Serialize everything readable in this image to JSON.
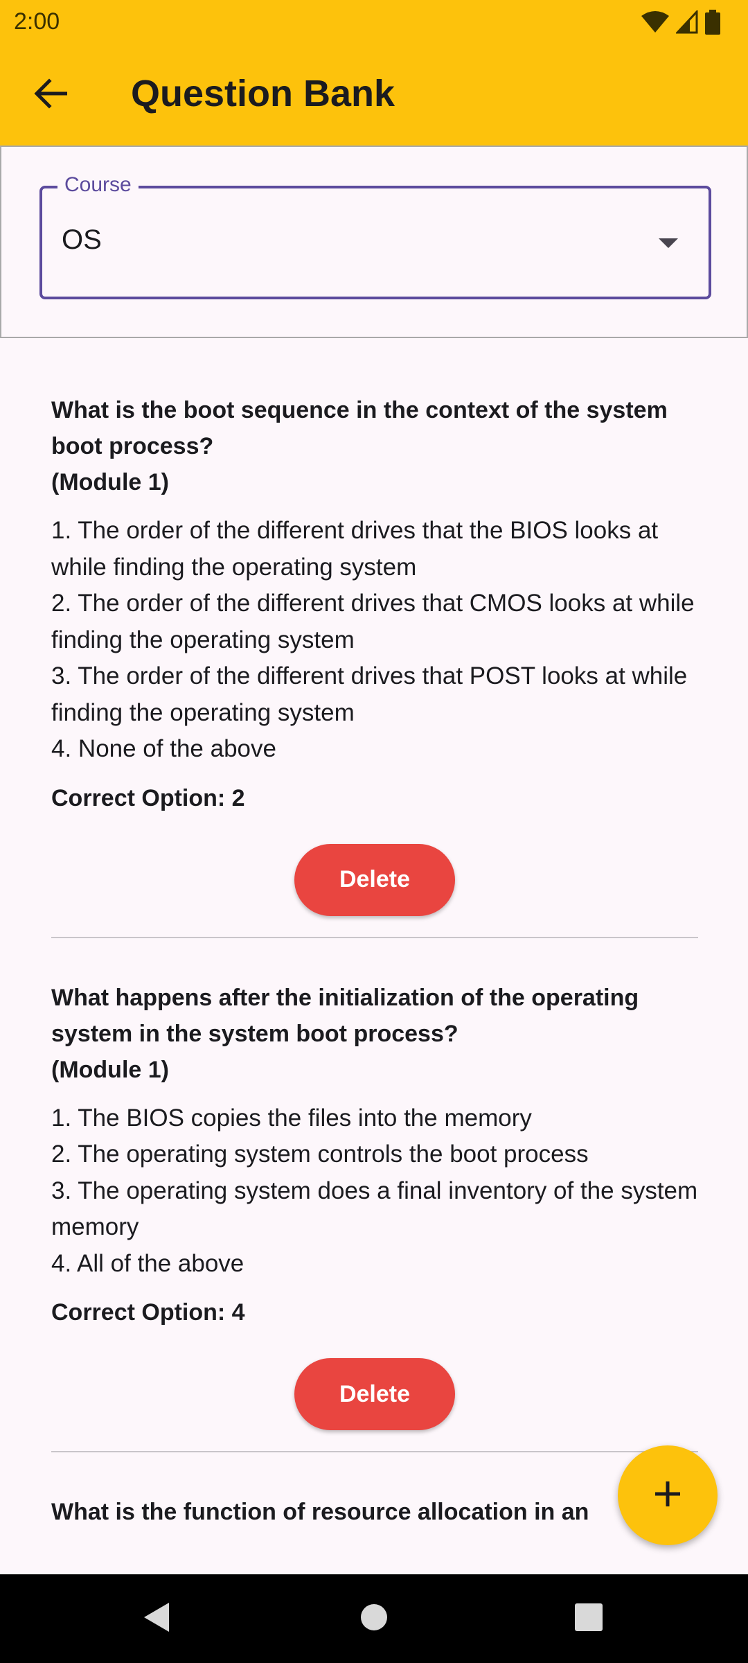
{
  "status_bar": {
    "time": "2:00",
    "icons": [
      "wifi-icon",
      "signal-icon",
      "battery-icon"
    ]
  },
  "app_bar": {
    "title": "Question Bank",
    "back_icon": "arrow-left-icon",
    "background": "#fdc20c"
  },
  "course": {
    "label": "Course",
    "value": "OS",
    "accent": "#5c4b9d"
  },
  "questions": [
    {
      "text": "What is the boot sequence in the context of the system boot process?",
      "module": "(Module 1)",
      "options": [
        "1. The order of the different drives that the BIOS looks at while finding the operating system",
        "2. The order of the different drives that CMOS looks at while finding the operating system",
        "3. The order of the different drives that POST looks at while finding the operating system",
        "4. None of the above"
      ],
      "correct": "Correct Option: 2",
      "delete_label": "Delete"
    },
    {
      "text": "What happens after the initialization of the operating system in the system boot process?",
      "module": "(Module 1)",
      "options": [
        "1. The BIOS copies the files into the memory",
        "2. The operating system controls the boot process",
        "3. The operating system does a final inventory of the system memory",
        "4. All of the above"
      ],
      "correct": "Correct Option: 4",
      "delete_label": "Delete"
    },
    {
      "text": "What is the function of resource allocation in an",
      "module": "",
      "options": [],
      "correct": "",
      "delete_label": ""
    }
  ],
  "fab": {
    "icon": "plus-icon",
    "background": "#fdc20c"
  },
  "delete_color": "#e94540",
  "nav": {
    "icons": [
      "back-triangle-icon",
      "home-circle-icon",
      "recents-square-icon"
    ]
  }
}
